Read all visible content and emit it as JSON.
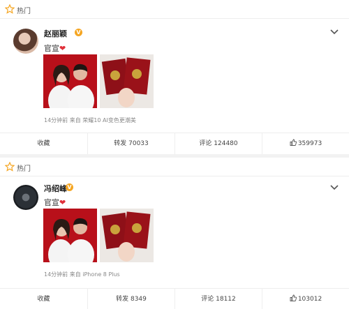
{
  "hot_label": "热门",
  "posts": [
    {
      "name": "赵丽颖",
      "text": "官宣",
      "meta": "14分钟前 来自 荣耀10 AI变色更潮美",
      "actions": {
        "collect": "收藏",
        "repost_label": "转发",
        "repost": "70033",
        "comment_label": "评论",
        "comment": "124480",
        "like": "359973"
      }
    },
    {
      "name": "冯绍峰",
      "text": "官宣",
      "meta": "14分钟前 来自 iPhone 8 Plus",
      "actions": {
        "collect": "收藏",
        "repost_label": "转发",
        "repost": "8349",
        "comment_label": "评论",
        "comment": "18112",
        "like": "103012"
      }
    }
  ],
  "colors": {
    "accent_orange": "#f5a623",
    "heart_red": "#e0303a",
    "photo_red": "#b8101a",
    "cert_red": "#8e1018"
  },
  "icons": [
    "hot-star-icon",
    "verified-badge-icon",
    "heart-icon",
    "chevron-down-icon",
    "thumb-up-icon"
  ]
}
